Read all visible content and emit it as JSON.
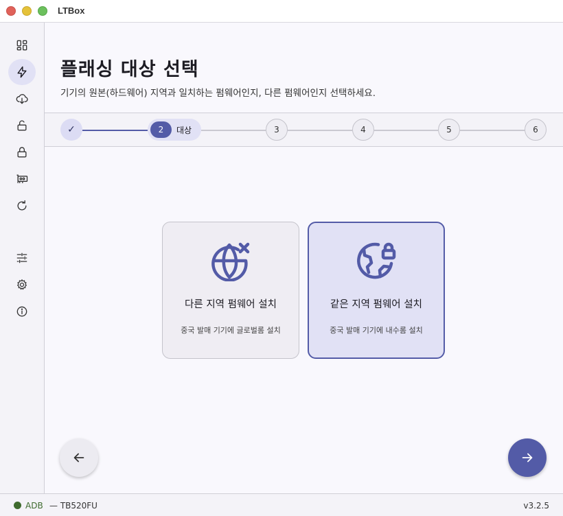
{
  "window": {
    "title": "LTBox"
  },
  "sidebar": {
    "items": [
      {
        "icon": "dashboard-icon",
        "active": false
      },
      {
        "icon": "flash-icon",
        "active": true
      },
      {
        "icon": "cloud-download-icon",
        "active": false
      },
      {
        "icon": "unlock-icon",
        "active": false
      },
      {
        "icon": "lock-icon",
        "active": false
      },
      {
        "icon": "chip-icon",
        "active": false
      },
      {
        "icon": "refresh-icon",
        "active": false
      },
      {
        "icon": "sliders-icon",
        "active": false
      },
      {
        "icon": "gear-icon",
        "active": false
      },
      {
        "icon": "info-icon",
        "active": false
      }
    ]
  },
  "page": {
    "title": "플래싱 대상 선택",
    "subtitle": "기기의 원본(하드웨어) 지역과 일치하는 펌웨어인지, 다른 펌웨어인지 선택하세요."
  },
  "stepper": {
    "steps": [
      {
        "label": "✓",
        "state": "done"
      },
      {
        "label": "2",
        "name": "대상",
        "state": "active"
      },
      {
        "label": "3",
        "state": "pending"
      },
      {
        "label": "4",
        "state": "pending"
      },
      {
        "label": "5",
        "state": "pending"
      },
      {
        "label": "6",
        "state": "pending"
      }
    ]
  },
  "options": [
    {
      "title": "다른 지역 펌웨어 설치",
      "desc": "중국 발매 기기에 글로벌롬 설치",
      "icon": "globe-x-icon",
      "selected": false
    },
    {
      "title": "같은 지역 펌웨어 설치",
      "desc": "중국 발매 기기에 내수롬 설치",
      "icon": "globe-lock-icon",
      "selected": true
    }
  ],
  "nav": {
    "back_icon": "arrow-left-icon",
    "next_icon": "arrow-right-icon"
  },
  "status": {
    "connection": "ADB",
    "device": "— TB520FU",
    "version": "v3.2.5",
    "connection_color": "#3f6b2f"
  },
  "colors": {
    "accent": "#535ba7",
    "accent_light": "#e1e1f5"
  }
}
